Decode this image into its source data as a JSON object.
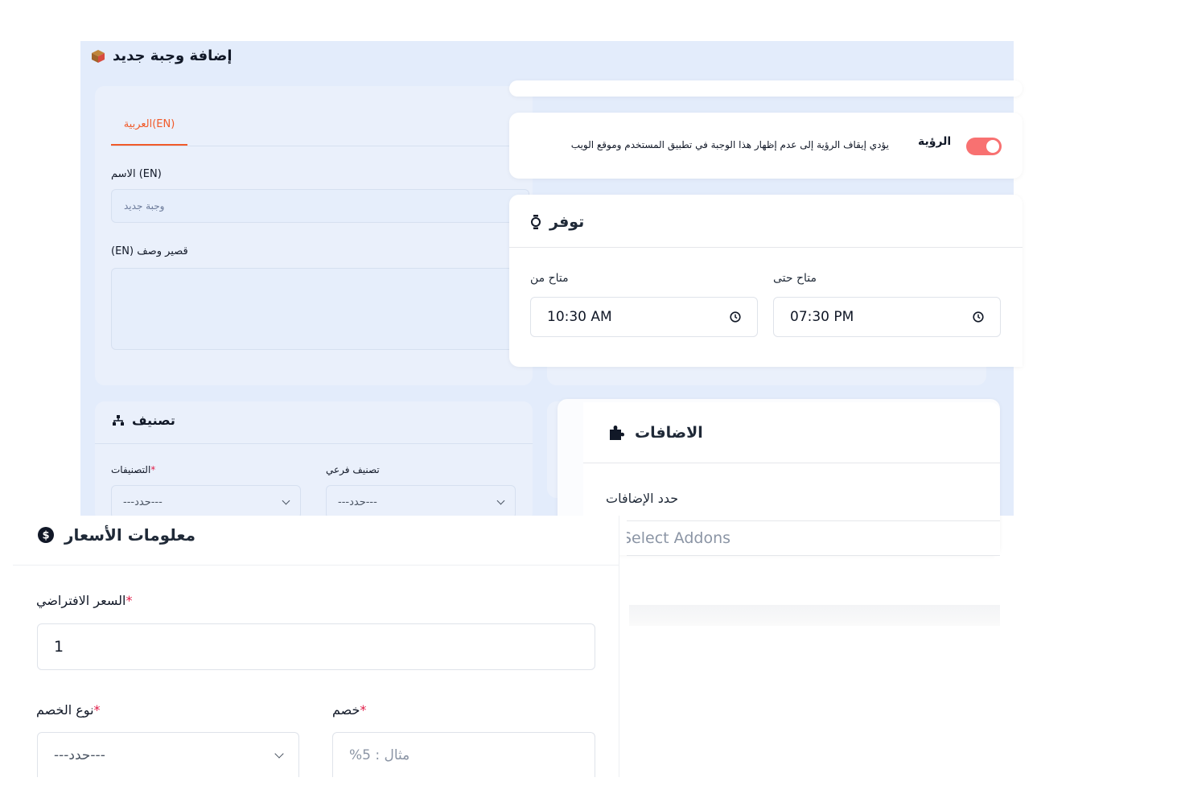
{
  "page": {
    "title": "إضافة وجبة جديد"
  },
  "lang_form": {
    "tab_label": "العربية(EN)",
    "name_label": "الاسم (EN)",
    "name_placeholder": "وجبة جديد",
    "desc_label": "(EN) قصير وصف"
  },
  "category": {
    "title": "تصنيف",
    "categories_label": "التصنيفات",
    "subcategory_label": "تصنيف فرعي",
    "select_placeholder": "---حدد---"
  },
  "visibility": {
    "label": "الرؤية",
    "description": "يؤدي إيقاف الرؤية إلى عدم إظهار هذا الوجبة في تطبيق المستخدم وموقع الويب",
    "enabled": true,
    "toggle_color": "#f87171"
  },
  "availability": {
    "title": "توفر",
    "from_label": "متاح من",
    "from_value": "10:30 AM",
    "to_label": "متاح حتى",
    "to_value": "07:30 PM"
  },
  "addons": {
    "title": "الاضافات",
    "limit_label": "حدد الإضافات",
    "select_placeholder": "Select Addons"
  },
  "pricing": {
    "title": "معلومات الأسعار",
    "default_price_label": "السعر الافتراضي",
    "default_price_value": "1",
    "discount_type_label": "نوع الخصم",
    "discount_type_placeholder": "---حدد---",
    "discount_label": "خصم",
    "discount_placeholder": "%مثال : 5"
  },
  "colors": {
    "accent": "#f15a29",
    "page_bg": "#e3ecfb",
    "required": "#e11d48"
  }
}
